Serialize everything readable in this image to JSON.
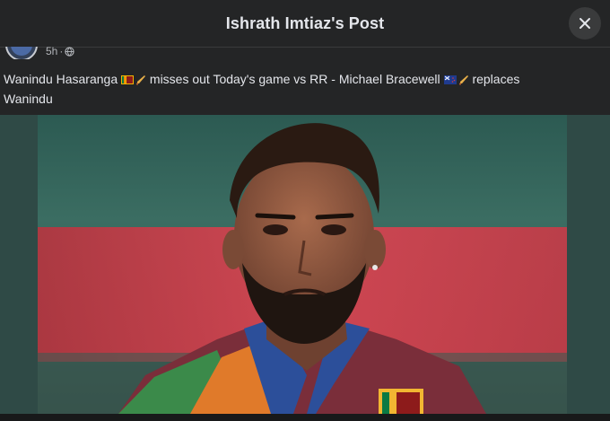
{
  "header": {
    "title": "Ishrath Imtiaz's Post"
  },
  "meta": {
    "time": "5h"
  },
  "post": {
    "name1": "Wanindu Hasaranga",
    "mid": "misses out Today's game vs RR - Michael Bracewell",
    "end": "replaces",
    "line2": "Wanindu"
  },
  "icons": {
    "close": "close-icon",
    "globe": "globe-icon",
    "flag_sl": "sri-lanka-flag-icon",
    "flag_nz": "new-zealand-flag-icon",
    "bat": "cricket-bat-icon"
  },
  "colors": {
    "background": "#242526",
    "text": "#e4e6eb",
    "secondary": "#b0b3b8",
    "button": "#3a3b3c",
    "image_backdrop": "#2f4a46"
  }
}
